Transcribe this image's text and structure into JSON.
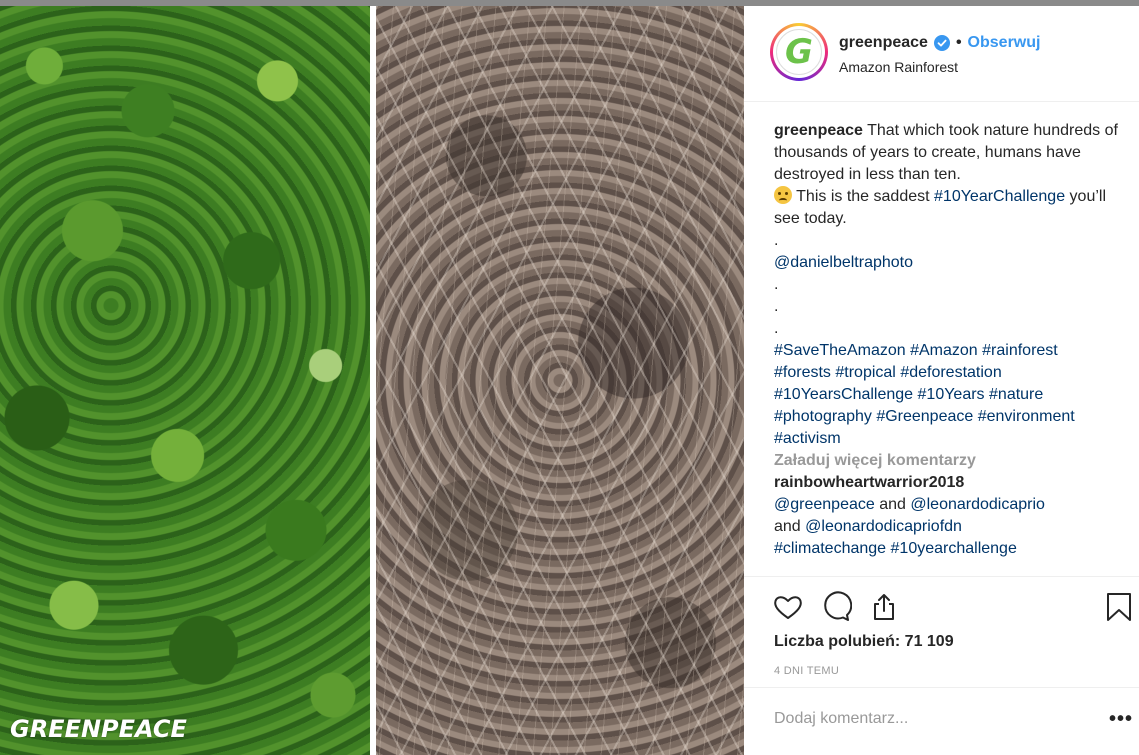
{
  "photo": {
    "watermark": "GREENPEACE"
  },
  "header": {
    "avatar_letter": "G",
    "username": "greenpeace",
    "separator": "•",
    "follow_label": "Obserwuj",
    "location": "Amazon Rainforest"
  },
  "caption": {
    "username": "greenpeace",
    "text1": "That which took nature hundreds of thousands of years to create, humans have destroyed in less than ten.",
    "text2": "This is the saddest",
    "hashtag_main": "#10YearChallenge",
    "text3": "you’ll see today.",
    "dot1": ".",
    "mention": "@danielbeltraphoto",
    "dot2": ".",
    "dot3": ".",
    "dot4": ".",
    "hashtags": [
      "#SaveTheAmazon",
      "#Amazon",
      "#rainforest",
      "#forests",
      "#tropical",
      "#deforestation",
      "#10YearsChallenge",
      "#10Years",
      "#nature",
      "#photography",
      "#Greenpeace",
      "#environment",
      "#activism"
    ]
  },
  "load_more": "Załaduj więcej komentarzy",
  "comment": {
    "username": "rainbowheartwarrior2018",
    "mention1": "@greenpeace",
    "and1": "and",
    "mention2": "@leonardodicaprio",
    "and2": "and",
    "mention3": "@leonardodicapriofdn",
    "tag1": "#climatechange",
    "tag2": "#10yearchallenge"
  },
  "actions": {
    "icons": [
      "heart-icon",
      "comment-icon",
      "share-icon",
      "bookmark-icon"
    ],
    "likes": "Liczba polubień: 71 109",
    "time_ago": "4 DNI TEMU"
  },
  "add_comment": {
    "placeholder": "Dodaj komentarz...",
    "more": "•••"
  },
  "colors": {
    "link": "#003569",
    "follow": "#3897f0",
    "verified": "#3897f0",
    "muted": "#999999"
  }
}
